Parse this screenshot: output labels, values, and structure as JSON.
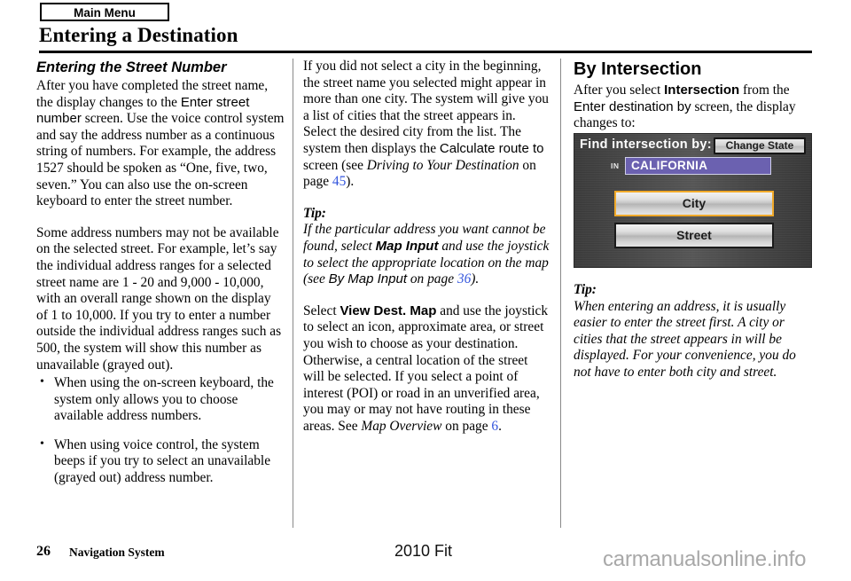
{
  "header": {
    "main_menu_label": "Main Menu",
    "title": "Entering a Destination"
  },
  "column1": {
    "heading": "Entering the Street Number",
    "para1_a": "After you have completed the street name, the display changes to the ",
    "para1_ui": "Enter street number",
    "para1_b": " screen. Use the voice control system and say the address number as a continuous string of numbers. For example, the address 1527 should be spoken as “One, five, two, seven.” You can also use the on-screen keyboard to enter the street number.",
    "para2": "Some address numbers may not be available on the selected street. For example, let’s say the individual address ranges for a selected street name are 1 - 20 and 9,000 - 10,000, with an overall range shown on the display of 1 to 10,000. If you try to enter a number outside the individual address ranges such as 500, the system will show this number as unavailable (grayed out).",
    "bullets": [
      "When using the on-screen keyboard, the system only allows you to choose available address numbers.",
      "When using voice control, the system beeps if you try to select an unavailable (grayed out) address number."
    ]
  },
  "column2": {
    "para1_a": "If you did not select a city in the beginning, the street name you selected might appear in more than one city. The system will give you a list of cities that the street appears in. Select the desired city from the list. The system then displays the ",
    "para1_ui": "Calculate route to",
    "para1_b": " screen (see ",
    "para1_italic": "Driving to Your Destination",
    "para1_c": " on page ",
    "para1_page": "45",
    "para1_d": ").",
    "tip_label": "Tip:",
    "tip_a": "If the particular address you want cannot be found, select ",
    "tip_ui": "Map Input",
    "tip_b": " and use the joystick to select the appropriate location on the map (see ",
    "tip_ref": "By Map Input",
    "tip_c": " on page ",
    "tip_page": "36",
    "tip_d": ").",
    "para2_a": "Select ",
    "para2_ui": "View Dest. Map",
    "para2_b": " and use the joystick to select an icon, approximate area, or street you wish to choose as your destination. Otherwise, a central location of the street will be selected. If you select a point of interest (POI) or road in an unverified area, you may or may not have routing in these areas. See ",
    "para2_italic": "Map Overview",
    "para2_c": " on page ",
    "para2_page": "6",
    "para2_d": "."
  },
  "column3": {
    "heading": "By Intersection",
    "para1_a": "After you select ",
    "para1_ui1": "Intersection",
    "para1_b": " from the ",
    "para1_ui2": "Enter destination by",
    "para1_c": " screen, the display changes to:",
    "tip_label": "Tip:",
    "tip_body": "When entering an address, it is usually easier to enter the street first. A city or cities that the street appears in will be displayed. For your convenience, you do not have to enter both city and street."
  },
  "nav_screen": {
    "find_label": "Find intersection by:",
    "change_state_label": "Change State",
    "in_label": "IN",
    "state_value": "CALIFORNIA",
    "city_button": "City",
    "street_button": "Street",
    "colors": {
      "state_field": "#6b61b0",
      "selected_border": "#f0a92a",
      "screen_bg": "#4a4a4a"
    }
  },
  "footer": {
    "page_number": "26",
    "manual_label": "Navigation System",
    "model_year": "2010 Fit",
    "watermark": "carmanualsonline.info"
  }
}
